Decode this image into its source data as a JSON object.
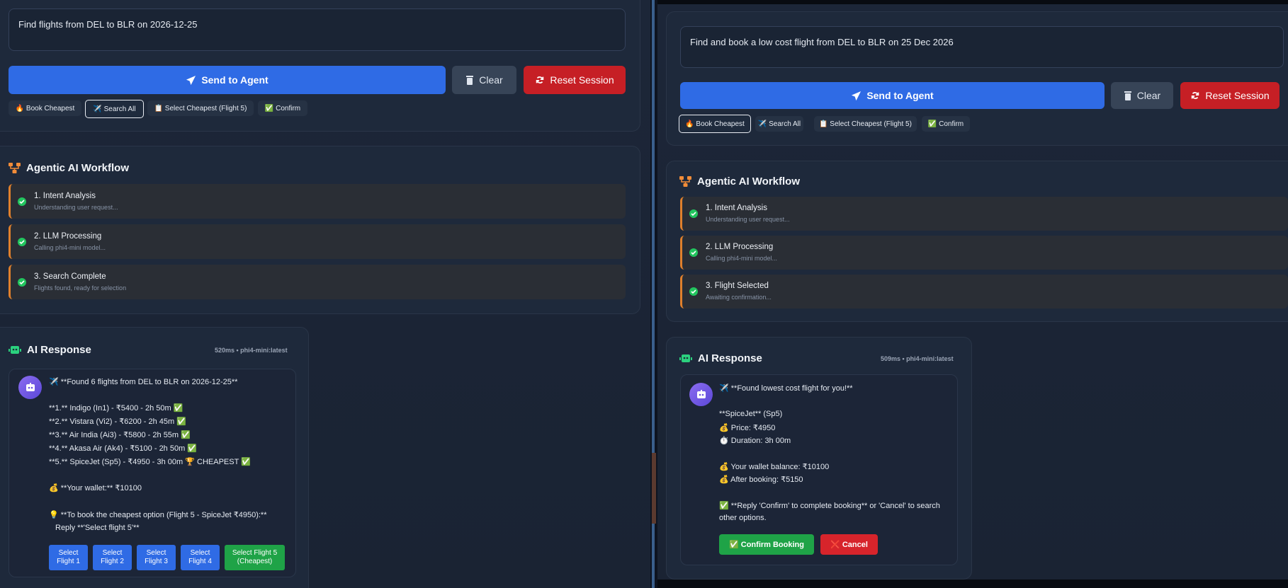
{
  "left": {
    "query": "Find flights from DEL to BLR on 2026-12-25",
    "send_label": "Send to Agent",
    "clear_label": "Clear",
    "reset_label": "Reset Session",
    "quick_actions": [
      "🔥 Book Cheapest",
      "✈️ Search All",
      "📋 Select Cheapest (Flight 5)",
      "✅ Confirm"
    ],
    "workflow_title": "Agentic AI Workflow",
    "steps": [
      {
        "title": "1. Intent Analysis",
        "sub": "Understanding user request..."
      },
      {
        "title": "2. LLM Processing",
        "sub": "Calling phi4-mini model..."
      },
      {
        "title": "3. Search Complete",
        "sub": "Flights found, ready for selection"
      }
    ],
    "response_title": "AI Response",
    "response_meta": "520ms • phi4-mini:latest",
    "response_lines": [
      "✈️ **Found 6 flights from DEL to BLR on 2026-12-25**",
      "**1.** Indigo (In1) - ₹5400 - 2h 50m ✅",
      "**2.** Vistara (Vi2) - ₹6200 - 2h 45m ✅",
      "**3.** Air India (Ai3) - ₹5800 - 2h 55m ✅",
      "**4.** Akasa Air (Ak4) - ₹5100 - 2h 50m ✅",
      "**5.** SpiceJet (Sp5) - ₹4950 - 3h 00m 🏆 CHEAPEST ✅",
      "💰 **Your wallet:** ₹10100",
      "💡 **To book the cheapest option (Flight 5 - SpiceJet ₹4950):**",
      "Reply **'Select flight 5'**"
    ],
    "select_buttons": [
      {
        "line1": "Select",
        "line2": "Flight 1"
      },
      {
        "line1": "Select",
        "line2": "Flight 2"
      },
      {
        "line1": "Select",
        "line2": "Flight 3"
      },
      {
        "line1": "Select",
        "line2": "Flight 4"
      },
      {
        "line1": "Select Flight 5",
        "line2": "(Cheapest)"
      }
    ]
  },
  "right": {
    "query": "Find and book a low cost flight from DEL to BLR on 25 Dec 2026",
    "send_label": "Send to Agent",
    "clear_label": "Clear",
    "reset_label": "Reset Session",
    "quick_actions": [
      "🔥 Book Cheapest",
      "✈️ Search All",
      "📋 Select Cheapest (Flight 5)",
      "✅ Confirm"
    ],
    "workflow_title": "Agentic AI Workflow",
    "steps": [
      {
        "title": "1. Intent Analysis",
        "sub": "Understanding user request..."
      },
      {
        "title": "2. LLM Processing",
        "sub": "Calling phi4-mini model..."
      },
      {
        "title": "3. Flight Selected",
        "sub": "Awaiting confirmation..."
      }
    ],
    "response_title": "AI Response",
    "response_meta": "509ms • phi4-mini:latest",
    "response_lines": [
      "✈️ **Found lowest cost flight for you!**",
      "**SpiceJet** (Sp5)",
      "💰 Price: ₹4950",
      "⏱️ Duration: 3h 00m",
      "💰 Your wallet balance: ₹10100",
      "💰 After booking: ₹5150",
      "✅ **Reply 'Confirm' to complete booking** or 'Cancel' to search",
      "other options."
    ],
    "confirm_label": "✅ Confirm Booking",
    "cancel_label": "❌ Cancel"
  },
  "colors": {
    "accent": "#2f6be5",
    "danger": "#c61f25",
    "success": "#22c55e",
    "step_border": "#e0802c"
  }
}
